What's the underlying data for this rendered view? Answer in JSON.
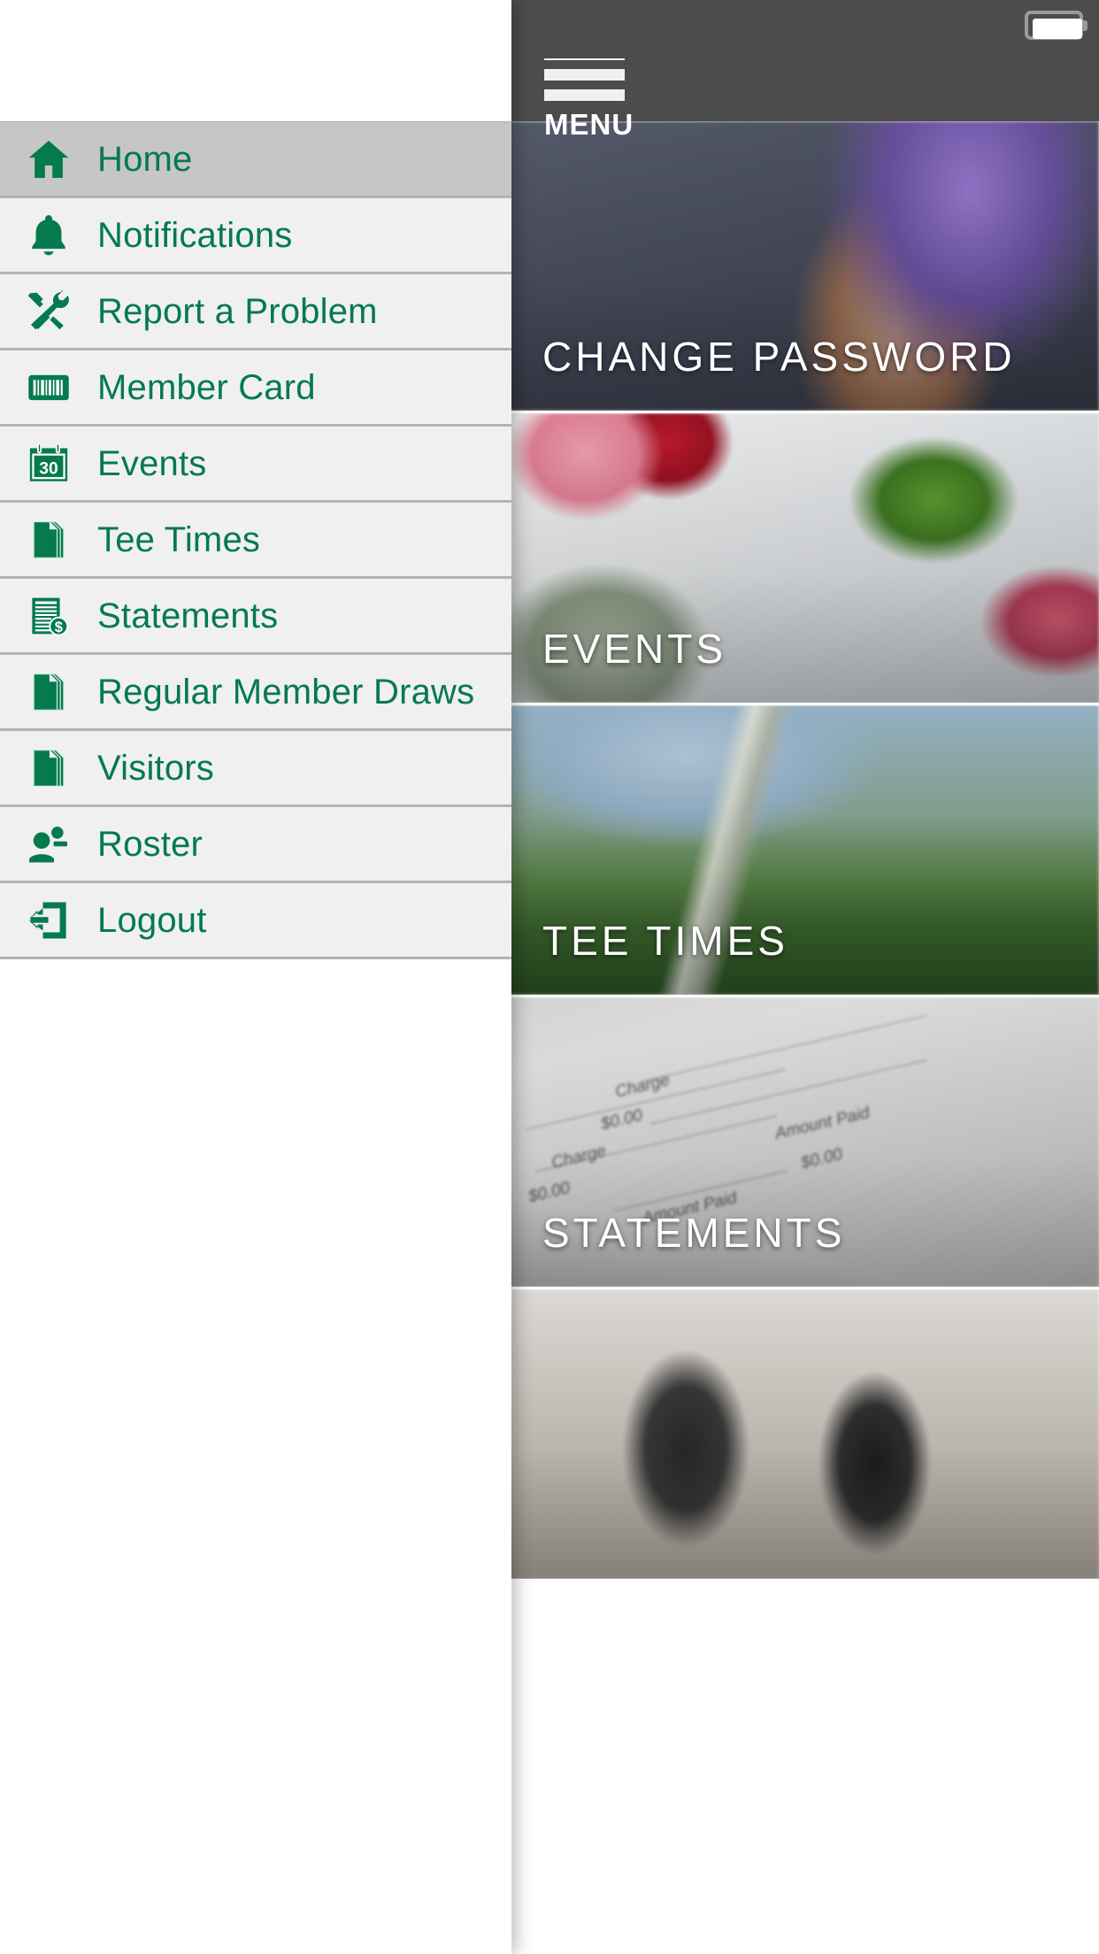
{
  "app": {
    "accent_color": "#047a4e",
    "appbar_color": "#4c4c4c",
    "drawer_item_bg": "#f0f0f0",
    "drawer_active_bg": "#c6c6c6",
    "divider_color": "#b3b3b3"
  },
  "statusbar": {
    "battery_icon": "battery-full-icon"
  },
  "appbar": {
    "menu_label": "MENU",
    "hamburger_icon": "hamburger-menu-icon"
  },
  "drawer": {
    "items": [
      {
        "label": "Home",
        "icon": "home-icon",
        "active": true
      },
      {
        "label": "Notifications",
        "icon": "bell-icon",
        "active": false
      },
      {
        "label": "Report a Problem",
        "icon": "tools-icon",
        "active": false
      },
      {
        "label": "Member Card",
        "icon": "barcode-icon",
        "active": false
      },
      {
        "label": "Events",
        "icon": "calendar-30-icon",
        "active": false
      },
      {
        "label": "Tee Times",
        "icon": "document-icon",
        "active": false
      },
      {
        "label": "Statements",
        "icon": "invoice-dollar-icon",
        "active": false
      },
      {
        "label": "Regular Member Draws",
        "icon": "document-icon",
        "active": false
      },
      {
        "label": "Visitors",
        "icon": "document-icon",
        "active": false
      },
      {
        "label": "Roster",
        "icon": "people-icon",
        "active": false
      },
      {
        "label": "Logout",
        "icon": "logout-icon",
        "active": false
      }
    ]
  },
  "tiles": [
    {
      "label": "CHANGE PASSWORD",
      "name": "tile-change-password"
    },
    {
      "label": "EVENTS",
      "name": "tile-events"
    },
    {
      "label": "TEE TIMES",
      "name": "tile-tee-times"
    },
    {
      "label": "STATEMENTS",
      "name": "tile-statements"
    },
    {
      "label": "",
      "name": "tile-next"
    }
  ],
  "statement_paper": {
    "labels": [
      "Charge",
      "$0.00",
      "Amount Paid",
      "Charge",
      "$0.00",
      "Amount Paid",
      "$0.00"
    ]
  }
}
